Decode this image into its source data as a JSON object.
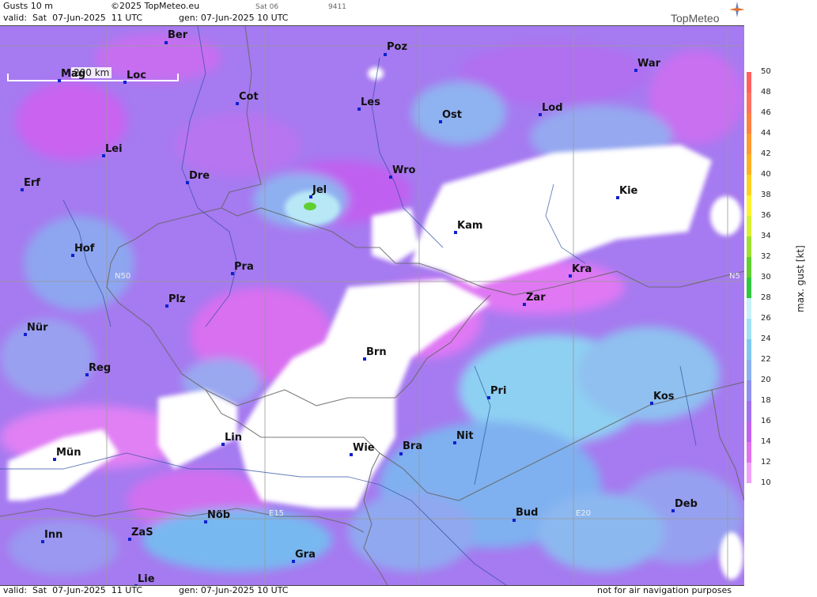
{
  "header": {
    "title": "Gusts 10 m",
    "copyright": "©2025 TopMeteo.eu",
    "valid": "valid:  Sat  07-Jun-2025  11 UTC",
    "gen": "gen: 07-Jun-2025 10 UTC",
    "run_small": "Sat 06",
    "code_small": "9411",
    "logo": "TopMeteo"
  },
  "footer": {
    "valid": "valid:  Sat  07-Jun-2025  11 UTC",
    "gen": "gen: 07-Jun-2025 10 UTC",
    "disclaimer": "not for air navigation purposes"
  },
  "scale": {
    "label": "200 km"
  },
  "grid_labels": {
    "lat": "N50",
    "lat_right": "N5",
    "lon1": "E15",
    "lon2": "E20"
  },
  "cities": [
    {
      "name": "Ber"
    },
    {
      "name": "Poz"
    },
    {
      "name": "War"
    },
    {
      "name": "Mag"
    },
    {
      "name": "Loc"
    },
    {
      "name": "Cot"
    },
    {
      "name": "Les"
    },
    {
      "name": "Ost"
    },
    {
      "name": "Lod"
    },
    {
      "name": "Lei"
    },
    {
      "name": "Dre"
    },
    {
      "name": "Wro"
    },
    {
      "name": "Erf"
    },
    {
      "name": "Jel"
    },
    {
      "name": "Kie"
    },
    {
      "name": "Kam"
    },
    {
      "name": "Hof"
    },
    {
      "name": "Pra"
    },
    {
      "name": "Kra"
    },
    {
      "name": "Plz"
    },
    {
      "name": "Zar"
    },
    {
      "name": "Nür"
    },
    {
      "name": "Brn"
    },
    {
      "name": "Reg"
    },
    {
      "name": "Pri"
    },
    {
      "name": "Kos"
    },
    {
      "name": "Lin"
    },
    {
      "name": "Nit"
    },
    {
      "name": "Bra"
    },
    {
      "name": "Wie"
    },
    {
      "name": "Mün"
    },
    {
      "name": "Nöb"
    },
    {
      "name": "Bud"
    },
    {
      "name": "Deb"
    },
    {
      "name": "Inn"
    },
    {
      "name": "ZaS"
    },
    {
      "name": "Gra"
    },
    {
      "name": "Lie"
    }
  ],
  "legend": {
    "title": "max. gust  [kt]",
    "ticks": [
      "50",
      "48",
      "46",
      "44",
      "42",
      "40",
      "38",
      "36",
      "34",
      "32",
      "30",
      "28",
      "26",
      "24",
      "22",
      "20",
      "18",
      "16",
      "14",
      "12",
      "10"
    ],
    "colors": [
      "#ff6060",
      "#ff7060",
      "#ff8040",
      "#ff9a30",
      "#ffb020",
      "#ffd020",
      "#fff030",
      "#d8f030",
      "#a0e030",
      "#60d030",
      "#30c840",
      "#c8f0f8",
      "#a0e0f4",
      "#80c8f0",
      "#8ab0f0",
      "#9090f0",
      "#a070f0",
      "#c060f0",
      "#e070f0",
      "#f0a0f8",
      "#ffffff"
    ]
  }
}
